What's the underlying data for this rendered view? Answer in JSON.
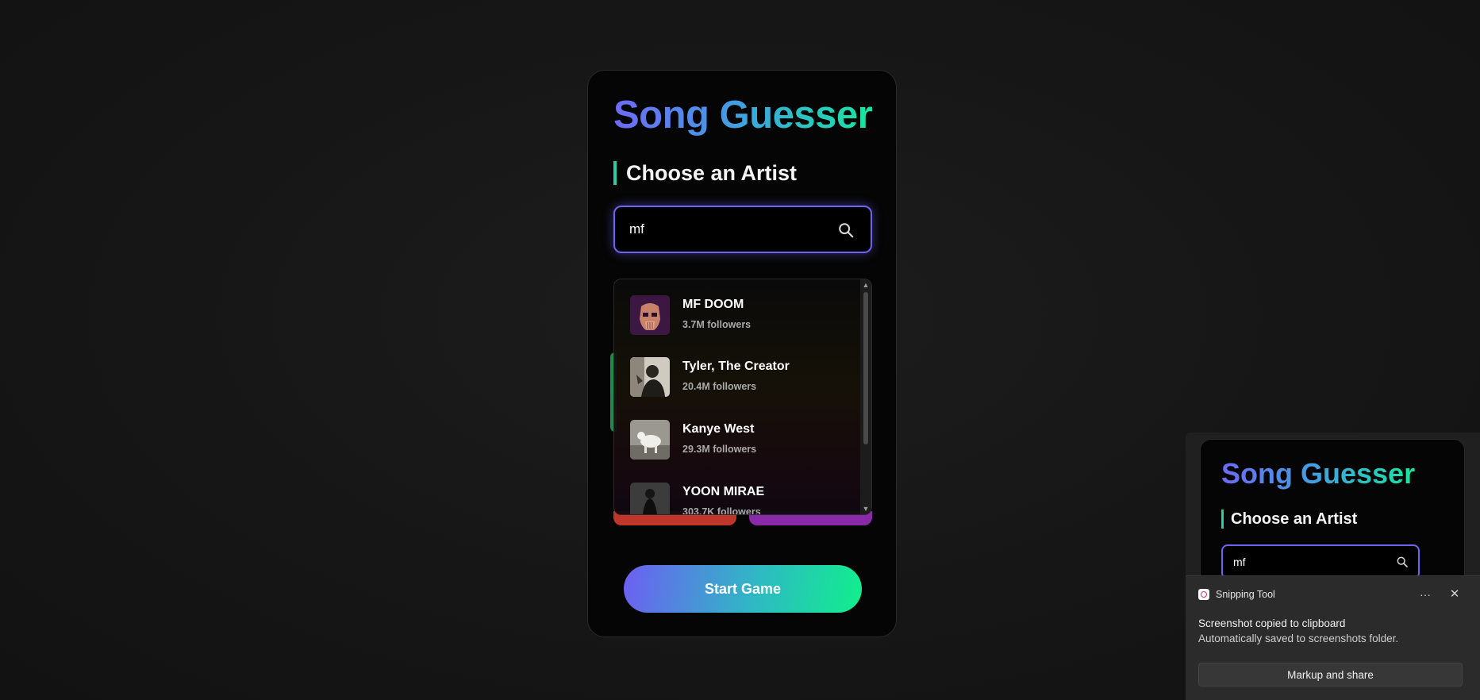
{
  "app": {
    "title": "Song Guesser",
    "section_heading": "Choose an Artist",
    "search": {
      "value": "mf",
      "icon": "search-icon"
    },
    "results": [
      {
        "name": "MF DOOM",
        "followers": "3.7M followers"
      },
      {
        "name": "Tyler, The Creator",
        "followers": "20.4M followers"
      },
      {
        "name": "Kanye West",
        "followers": "29.3M followers"
      },
      {
        "name": "YOON MIRAE",
        "followers": "303.7K followers"
      }
    ],
    "start_button": "Start Game",
    "colors": {
      "accent_purple": "#6f63f2",
      "accent_green": "#10ef8c",
      "accent_blue": "#3fa2e0"
    }
  },
  "preview": {
    "title": "Song Guesser",
    "section_heading": "Choose an Artist",
    "search_value": "mf"
  },
  "toast": {
    "app_name": "Snipping Tool",
    "more": "···",
    "close": "✕",
    "heading": "Screenshot copied to clipboard",
    "subtext": "Automatically saved to screenshots folder.",
    "button": "Markup and share"
  }
}
